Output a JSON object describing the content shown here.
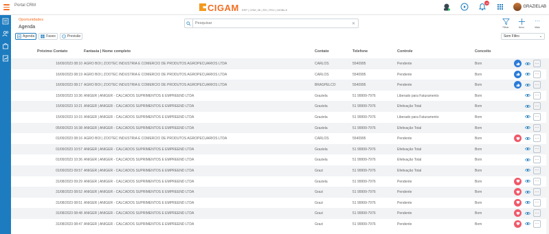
{
  "app": {
    "portal_title": "Portal CRM",
    "brand_name": "CIGAM",
    "brand_tagline": "ERP | CRM | BI | RH | PDV | MOBILE",
    "notification_count": "10",
    "username": "GRAZIELAB"
  },
  "breadcrumb": {
    "parent": "Oportunidades",
    "current": "Agenda"
  },
  "search": {
    "placeholder": "Pesquisar",
    "value": ""
  },
  "actions": {
    "filter_label": "Filtrar",
    "new_label": "Novo",
    "more_label": "Mais"
  },
  "tabs": [
    {
      "label": "Agenda",
      "active": true
    },
    {
      "label": "Fases",
      "active": false
    },
    {
      "label": "Previsão",
      "active": false
    }
  ],
  "filter_select": {
    "value": "Sem Filtro"
  },
  "columns": {
    "next_contact": "Próximo Contato",
    "name": "Fantasia | Nome completo",
    "contact": "Contato",
    "phone": "Telefone",
    "control": "Controle",
    "concept": "Conceito"
  },
  "rows": [
    {
      "date": "16/09/2023 08:10",
      "name": "AGRO BOI | ZOOTEC INDUSTRIA E COMERCIO DE PRODUTOS AGROPECUARIOS LTDA",
      "contact": "CARLOS",
      "phone": "5540995",
      "control": "Pendente",
      "concept": "Bom",
      "rating": "up"
    },
    {
      "date": "16/09/2023 08:19",
      "name": "AGRO BOI | ZOOTEC INDUSTRIA E COMERCIO DE PRODUTOS AGROPECUARIOS LTDA",
      "contact": "CARLOS",
      "phone": "5540995",
      "control": "Pendente",
      "concept": "Bom",
      "rating": "up"
    },
    {
      "date": "16/09/2023 08:17",
      "name": "AGRO BOI | ZOOTEC INDUSTRIA E COMERCIO DE PRODUTOS AGROPECUARIOS LTDA",
      "contact": "BRASPELCO",
      "phone": "5540995",
      "control": "Pendente",
      "concept": "Bom",
      "rating": "up"
    },
    {
      "date": "15/09/2023 10:36",
      "name": "ANIGER | ANIGER - CALCADOS SUPRIMENTOS E EMPREEND LTDA",
      "contact": "Graziela",
      "phone": "51 99999-7976",
      "control": "Liberado para Faturamento",
      "concept": "Bom",
      "rating": "none"
    },
    {
      "date": "15/09/2023 10:21",
      "name": "ANIGER | ANIGER - CALCADOS SUPRIMENTOS E EMPREEND LTDA",
      "contact": "Graziela",
      "phone": "51 99999-7976",
      "control": "Efetivação Total",
      "concept": "Bom",
      "rating": "none"
    },
    {
      "date": "15/09/2023 10:15",
      "name": "ANIGER | ANIGER - CALCADOS SUPRIMENTOS E EMPREEND LTDA",
      "contact": "Graziela",
      "phone": "51 99999-7976",
      "control": "Liberado para Faturamento",
      "concept": "Bom",
      "rating": "none"
    },
    {
      "date": "05/09/2023 16:38",
      "name": "ANIGER | ANIGER - CALCADOS SUPRIMENTOS E EMPREEND LTDA",
      "contact": "Graziela",
      "phone": "51 99999-7976",
      "control": "Efetivação Total",
      "concept": "Bom",
      "rating": "none"
    },
    {
      "date": "01/09/2023 08:16",
      "name": "AGRO BOI | ZOOTEC INDUSTRIA E COMERCIO DE PRODUTOS AGROPECUARIOS LTDA",
      "contact": "CARLOS",
      "phone": "5540995",
      "control": "Pendente",
      "concept": "Bom",
      "rating": "down"
    },
    {
      "date": "01/09/2023 10:57",
      "name": "ANIGER | ANIGER - CALCADOS SUPRIMENTOS E EMPREEND LTDA",
      "contact": "Graziela",
      "phone": "51 99999-7976",
      "control": "Efetivação Total",
      "concept": "Bom",
      "rating": "none"
    },
    {
      "date": "01/09/2023 10:36",
      "name": "ANIGER | ANIGER - CALCADOS SUPRIMENTOS E EMPREEND LTDA",
      "contact": "Graziela",
      "phone": "51 99999-7976",
      "control": "Efetivação Total",
      "concept": "Bom",
      "rating": "none"
    },
    {
      "date": "01/09/2023 09:57",
      "name": "ANIGER | ANIGER - CALCADOS SUPRIMENTOS E EMPREEND LTDA",
      "contact": "Grazi",
      "phone": "51 99999-7976",
      "control": "Efetivação Total",
      "concept": "Bom",
      "rating": "none"
    },
    {
      "date": "31/08/2023 09:29",
      "name": "ANIGER | ANIGER - CALCADOS SUPRIMENTOS E EMPREEND LTDA",
      "contact": "Graziela",
      "phone": "51 99999-7976",
      "control": "Pendente",
      "concept": "Bom",
      "rating": "down"
    },
    {
      "date": "31/08/2023 08:52",
      "name": "ANIGER | ANIGER - CALCADOS SUPRIMENTOS E EMPREEND LTDA",
      "contact": "Grazi",
      "phone": "51 99999-7976",
      "control": "Pendente",
      "concept": "Bom",
      "rating": "down"
    },
    {
      "date": "31/08/2023 08:51",
      "name": "ANIGER | ANIGER - CALCADOS SUPRIMENTOS E EMPREEND LTDA",
      "contact": "Grazi",
      "phone": "51 99999-7976",
      "control": "Pendente",
      "concept": "Bom",
      "rating": "down"
    },
    {
      "date": "31/08/2023 08:48",
      "name": "ANIGER | ANIGER - CALCADOS SUPRIMENTOS E EMPREEND LTDA",
      "contact": "Grazi",
      "phone": "51 99999-7976",
      "control": "Pendente",
      "concept": "Bom",
      "rating": "down"
    },
    {
      "date": "31/08/2023 08:47",
      "name": "ANIGER | ANIGER - CALCADOS SUPRIMENTOS E EMPREEND LTDA",
      "contact": "Grazi",
      "phone": "51 99999-7976",
      "control": "Pendente",
      "concept": "Bom",
      "rating": "down"
    }
  ],
  "colors": {
    "accent": "#f36d21",
    "sidebar": "#1d7cbf",
    "like": "#2b7bd8",
    "dislike": "#f0596b"
  }
}
